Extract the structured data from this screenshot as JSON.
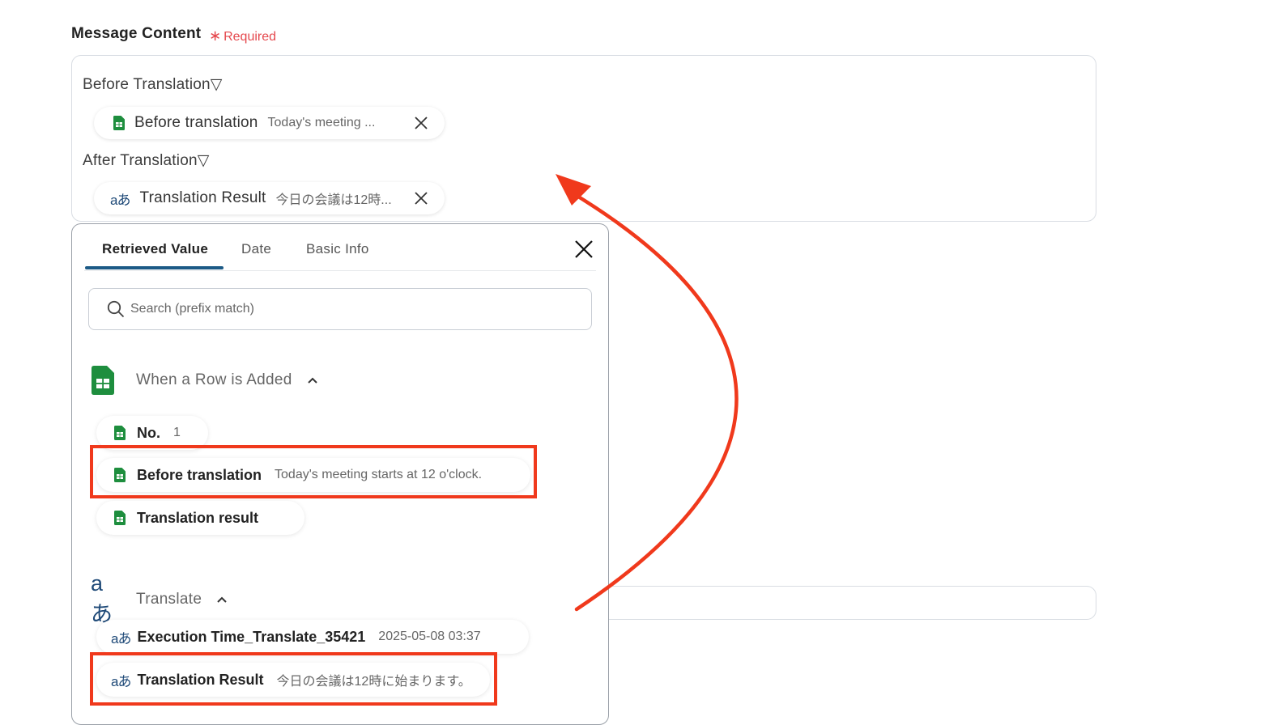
{
  "field": {
    "label": "Message Content",
    "required_mark": "∗",
    "required_text": "Required"
  },
  "message": {
    "before_section_label": "Before Translation▽",
    "before_chip": {
      "label": "Before translation",
      "value": "Today's meeting ..."
    },
    "after_section_label": "After Translation▽",
    "after_chip": {
      "label": "Translation Result",
      "value": "今日の会議は12時..."
    }
  },
  "panel": {
    "tabs": [
      "Retrieved Value",
      "Date",
      "Basic Info"
    ],
    "active_tab": "Retrieved Value",
    "search_placeholder": "Search (prefix match)",
    "groups": [
      {
        "title": "When a Row is Added",
        "icon": "google-sheets-icon",
        "items": [
          {
            "name": "No.",
            "value": "1"
          },
          {
            "name": "Before translation",
            "value": "Today's meeting starts at 12 o'clock."
          },
          {
            "name": "Translation result",
            "value": ""
          }
        ]
      },
      {
        "title": "Translate",
        "icon": "translate-icon",
        "items": [
          {
            "name": "Execution Time_Translate_35421",
            "value": "2025-05-08 03:37"
          },
          {
            "name": "Translation Result",
            "value": "今日の会議は12時に始まります。"
          }
        ]
      }
    ]
  },
  "icons": {
    "translate_glyph": "aあ"
  },
  "colors": {
    "highlight": "#f0391c",
    "accent": "#1c5a86",
    "sheets_green": "#1e8e3e",
    "required_red": "#e5484d"
  }
}
